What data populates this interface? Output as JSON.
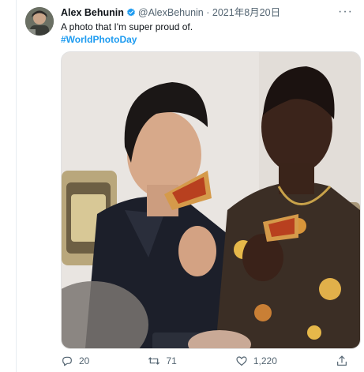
{
  "tweet": {
    "display_name": "Alex Behunin",
    "handle": "@AlexBehunin",
    "separator": "·",
    "date": "2021年8月20日",
    "text": "A photo that I'm super proud of.",
    "hashtag": "#WorldPhotoDay"
  },
  "actions": {
    "reply_count": "20",
    "retweet_count": "71",
    "like_count": "1,220"
  },
  "icons": {
    "verified": "verified-badge-icon",
    "more": "more-options-icon",
    "reply": "reply-icon",
    "retweet": "retweet-icon",
    "like": "like-heart-icon",
    "share": "share-icon"
  },
  "colors": {
    "accent": "#1d9bf0",
    "text": "#0f1419",
    "muted": "#536471"
  }
}
